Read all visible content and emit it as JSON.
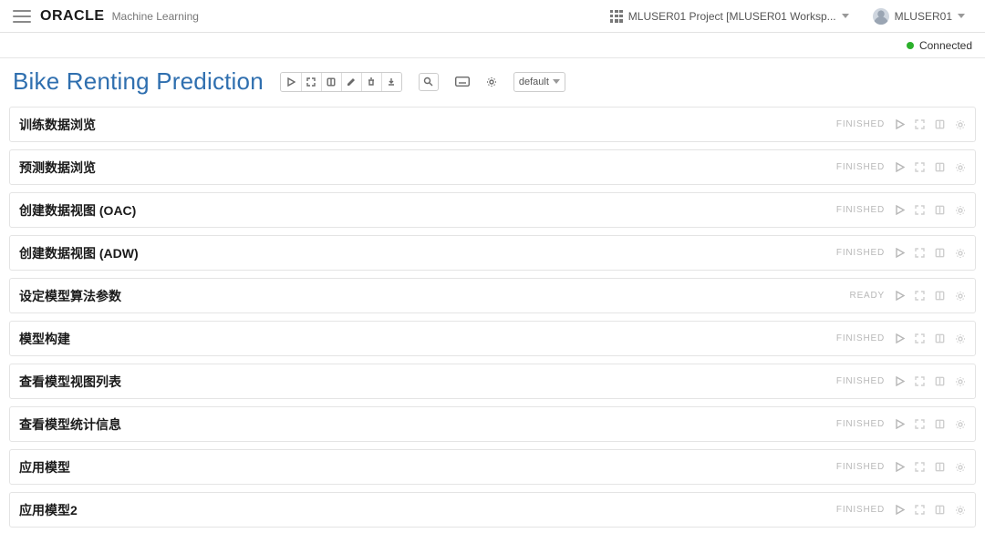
{
  "header": {
    "brand_logo": "ORACLE",
    "brand_suffix": "Machine Learning",
    "project_label": "MLUSER01 Project [MLUSER01 Worksp...",
    "user_label": "MLUSER01"
  },
  "status": {
    "connected_label": "Connected",
    "connected_color": "#2bb02b"
  },
  "notebook": {
    "title": "Bike Renting Prediction",
    "layout_dropdown": "default"
  },
  "toolbar_icons": {
    "run_all": "play-icon",
    "expand": "expand-icon",
    "code_toggle": "code-toggle-icon",
    "edit": "edit-icon",
    "delete": "trash-icon",
    "download": "download-icon",
    "search": "search-icon",
    "keyboard": "keyboard-icon",
    "settings": "gear-icon"
  },
  "paragraphs": [
    {
      "title": "训练数据浏览",
      "status": "FINISHED"
    },
    {
      "title": "预测数据浏览",
      "status": "FINISHED"
    },
    {
      "title": "创建数据视图 (OAC)",
      "status": "FINISHED"
    },
    {
      "title": "创建数据视图 (ADW)",
      "status": "FINISHED"
    },
    {
      "title": "设定模型算法参数",
      "status": "READY"
    },
    {
      "title": "模型构建",
      "status": "FINISHED"
    },
    {
      "title": "查看模型视图列表",
      "status": "FINISHED"
    },
    {
      "title": "查看模型统计信息",
      "status": "FINISHED"
    },
    {
      "title": "应用模型",
      "status": "FINISHED"
    },
    {
      "title": "应用模型2",
      "status": "FINISHED"
    }
  ],
  "paragraph_action_icons": {
    "run": "play-icon",
    "expand": "expand-icon",
    "code": "code-toggle-icon",
    "settings": "gear-icon"
  }
}
